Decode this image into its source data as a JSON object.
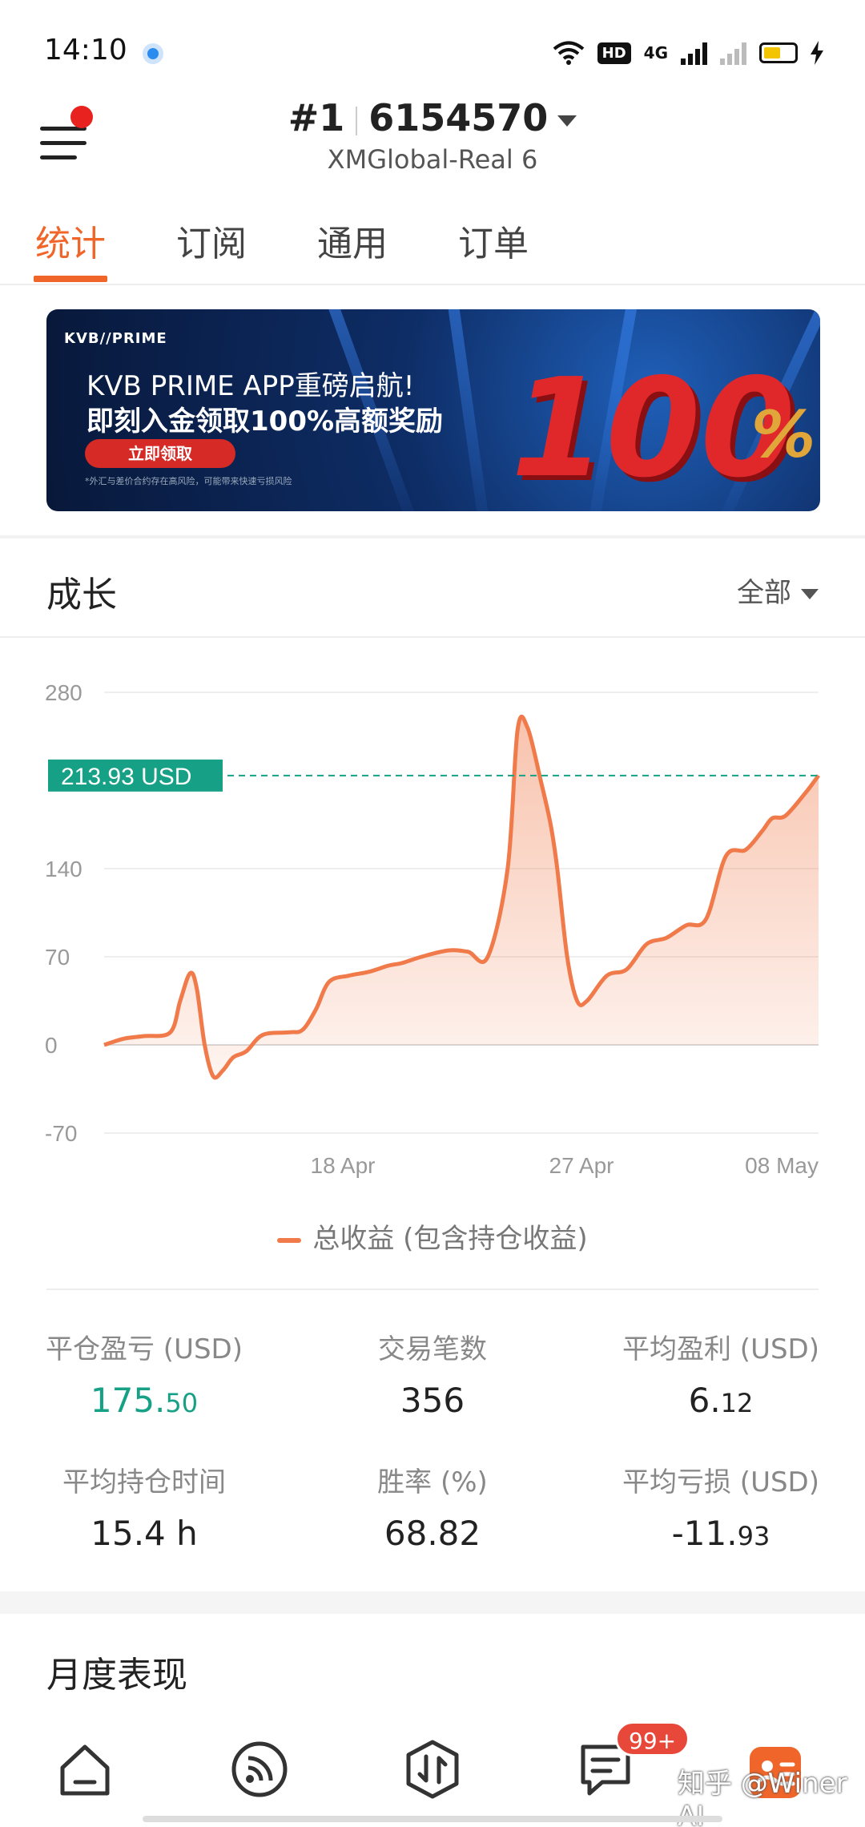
{
  "status_bar": {
    "time": "14:10",
    "icons": [
      "location-dot-icon",
      "wifi-icon",
      "hd-icon",
      "4g-signal-icon",
      "no-signal-icon",
      "battery-icon",
      "charging-icon"
    ],
    "hd": "HD",
    "net": "4G"
  },
  "header": {
    "rank": "#1",
    "account": "6154570",
    "server": "XMGlobal-Real 6"
  },
  "tabs": [
    {
      "label": "统计"
    },
    {
      "label": "订阅"
    },
    {
      "label": "通用"
    },
    {
      "label": "订单"
    }
  ],
  "banner": {
    "logo": "KVB//PRIME",
    "line1": "KVB PRIME APP重磅启航!",
    "line2": "即刻入金领取100%高额奖励",
    "button": "立即领取",
    "disclaimer": "*外汇与差价合约存在高风险，可能带来快速亏损风险",
    "big": "100",
    "pct": "%"
  },
  "growth": {
    "title": "成长",
    "filter": "全部"
  },
  "chart_data": {
    "type": "area",
    "ylim": [
      -70,
      280
    ],
    "yticks": [
      "280",
      "140",
      "70",
      "0",
      "-70"
    ],
    "xticks": [
      "18 Apr",
      "27 Apr",
      "08 May"
    ],
    "current_label": "213.93 USD",
    "current_value": 213.93,
    "legend": "总收益 (包含持仓收益)",
    "accent_color": "#f07a4a",
    "marker_color": "#16a085",
    "series": [
      {
        "name": "总收益 (包含持仓收益)",
        "points": [
          [
            0,
            0
          ],
          [
            3,
            5
          ],
          [
            6,
            7
          ],
          [
            10,
            10
          ],
          [
            11.5,
            35
          ],
          [
            13,
            57
          ],
          [
            14,
            45
          ],
          [
            15.2,
            0
          ],
          [
            16.5,
            -25
          ],
          [
            18,
            -20
          ],
          [
            19.5,
            -10
          ],
          [
            21.5,
            -5
          ],
          [
            24,
            8
          ],
          [
            28,
            10
          ],
          [
            30,
            12
          ],
          [
            32,
            28
          ],
          [
            34,
            50
          ],
          [
            37,
            55
          ],
          [
            40,
            58
          ],
          [
            43,
            63
          ],
          [
            45,
            65
          ],
          [
            48,
            70
          ],
          [
            52,
            75
          ],
          [
            55,
            74
          ],
          [
            58,
            70
          ],
          [
            61,
            140
          ],
          [
            62.5,
            250
          ],
          [
            64,
            252
          ],
          [
            66,
            210
          ],
          [
            67.5,
            175
          ],
          [
            68.5,
            140
          ],
          [
            70,
            70
          ],
          [
            71.5,
            35
          ],
          [
            73,
            35
          ],
          [
            76,
            55
          ],
          [
            79,
            60
          ],
          [
            82,
            80
          ],
          [
            85,
            85
          ],
          [
            88,
            95
          ],
          [
            91,
            100
          ],
          [
            94,
            150
          ],
          [
            97,
            155
          ],
          [
            99.5,
            170
          ],
          [
            101,
            180
          ],
          [
            103,
            182
          ],
          [
            106,
            200
          ],
          [
            108,
            214
          ]
        ]
      }
    ]
  },
  "stats": [
    {
      "label": "平仓盈亏 (USD)",
      "int": "175.",
      "dec": "50",
      "green": true
    },
    {
      "label": "交易笔数",
      "int": "356",
      "dec": "",
      "green": false
    },
    {
      "label": "平均盈利 (USD)",
      "int": "6.",
      "dec": "12",
      "green": false
    },
    {
      "label": "平均持仓时间",
      "int": "15.4 h",
      "dec": "",
      "green": false
    },
    {
      "label": "胜率 (%)",
      "int": "68.82",
      "dec": "",
      "green": false
    },
    {
      "label": "平均亏损 (USD)",
      "int": "-11.",
      "dec": "93",
      "green": false
    }
  ],
  "monthly": {
    "title": "月度表现"
  },
  "bottom_nav": {
    "items": [
      "home-icon",
      "feed-icon",
      "trade-icon",
      "messages-icon",
      "profile-icon"
    ],
    "badge": "99+",
    "watermark": "知乎 @Winer AI"
  }
}
